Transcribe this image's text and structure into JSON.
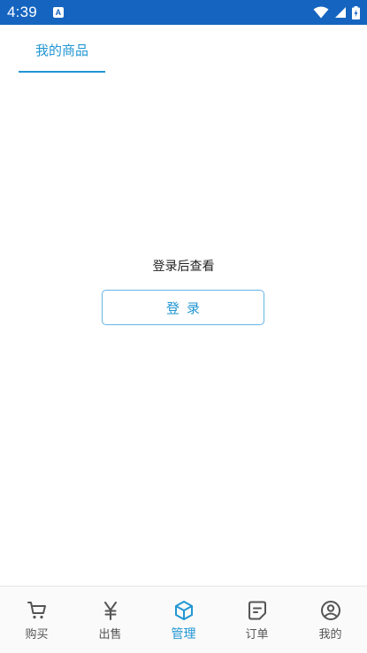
{
  "status_bar": {
    "time": "4:39",
    "notification_badge": "A",
    "icons": [
      "wifi-icon",
      "signal-icon",
      "battery-icon"
    ]
  },
  "tabs": [
    {
      "label": "我的商品",
      "active": true
    }
  ],
  "empty_state": {
    "message": "登录后查看",
    "login_label": "登录"
  },
  "bottom_nav": {
    "items": [
      {
        "label": "购买",
        "icon": "cart-icon",
        "active": false
      },
      {
        "label": "出售",
        "icon": "yen-icon",
        "active": false
      },
      {
        "label": "管理",
        "icon": "box-icon",
        "active": true
      },
      {
        "label": "订单",
        "icon": "order-icon",
        "active": false
      },
      {
        "label": "我的",
        "icon": "profile-icon",
        "active": false
      }
    ]
  },
  "colors": {
    "status_bar": "#1565c0",
    "accent": "#2196d3",
    "inactive": "#555555"
  }
}
